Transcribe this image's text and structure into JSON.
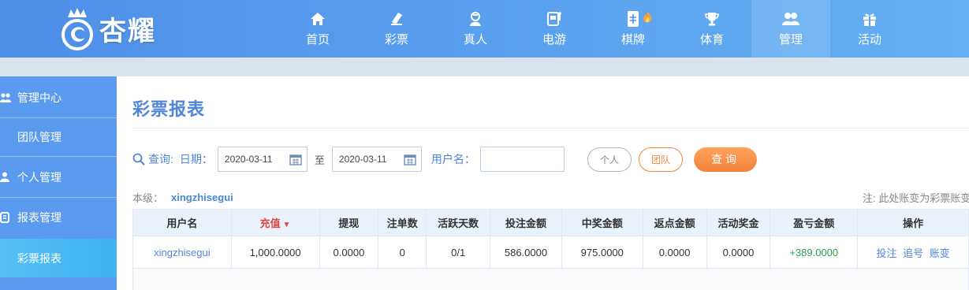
{
  "brand": {
    "name": "杏耀"
  },
  "nav": [
    {
      "label": "首页",
      "icon": "home-icon"
    },
    {
      "label": "彩票",
      "icon": "ticket-icon"
    },
    {
      "label": "真人",
      "icon": "dealer-icon"
    },
    {
      "label": "电游",
      "icon": "slot-machine-icon"
    },
    {
      "label": "棋牌",
      "icon": "mahjong-icon"
    },
    {
      "label": "体育",
      "icon": "trophy-icon"
    },
    {
      "label": "管理",
      "icon": "users-icon",
      "active": true
    },
    {
      "label": "活动",
      "icon": "gift-icon"
    }
  ],
  "sidebar": {
    "items": [
      {
        "label": "管理中心",
        "icon": "users-icon"
      },
      {
        "label": "团队管理"
      },
      {
        "label": "个人管理",
        "icon": "user-icon"
      },
      {
        "label": "报表管理",
        "icon": "report-icon"
      },
      {
        "label": "彩票报表",
        "active": true
      }
    ]
  },
  "page": {
    "title": "彩票报表"
  },
  "filter": {
    "query_label": "查询:",
    "date_label": "日期：",
    "date_from": "2020-03-11",
    "to_label": "至",
    "date_to": "2020-03-11",
    "username_label": "用户名：",
    "username_value": "",
    "personal_label": "个人",
    "team_label": "团队",
    "search_label": "查询"
  },
  "level": {
    "label": "本级：",
    "value": "xingzhisegui"
  },
  "note": "注: 此处账变为彩票账变",
  "table": {
    "headers": [
      "用户名",
      "充值",
      "提现",
      "注单数",
      "活跃天数",
      "投注金额",
      "中奖金额",
      "返点金额",
      "活动奖金",
      "盈亏金额",
      "操作"
    ],
    "sorted_column": "充值",
    "rows": [
      {
        "username": "xingzhisegui",
        "recharge": "1,000.0000",
        "withdraw": "0.0000",
        "orders": "0",
        "active_days": "0/1",
        "bet_amount": "586.0000",
        "win_amount": "975.0000",
        "rebate": "0.0000",
        "bonus": "0.0000",
        "profit": "+389.0000",
        "actions": [
          "投注",
          "追号",
          "账变"
        ]
      }
    ]
  },
  "colors": {
    "accent": "#4f86d8",
    "sidebar": "#5b9bef",
    "sidebar_active": "#45b6f1",
    "sort": "#e04545",
    "profit_positive": "#2aa04a",
    "orange": "#f08a3e"
  }
}
